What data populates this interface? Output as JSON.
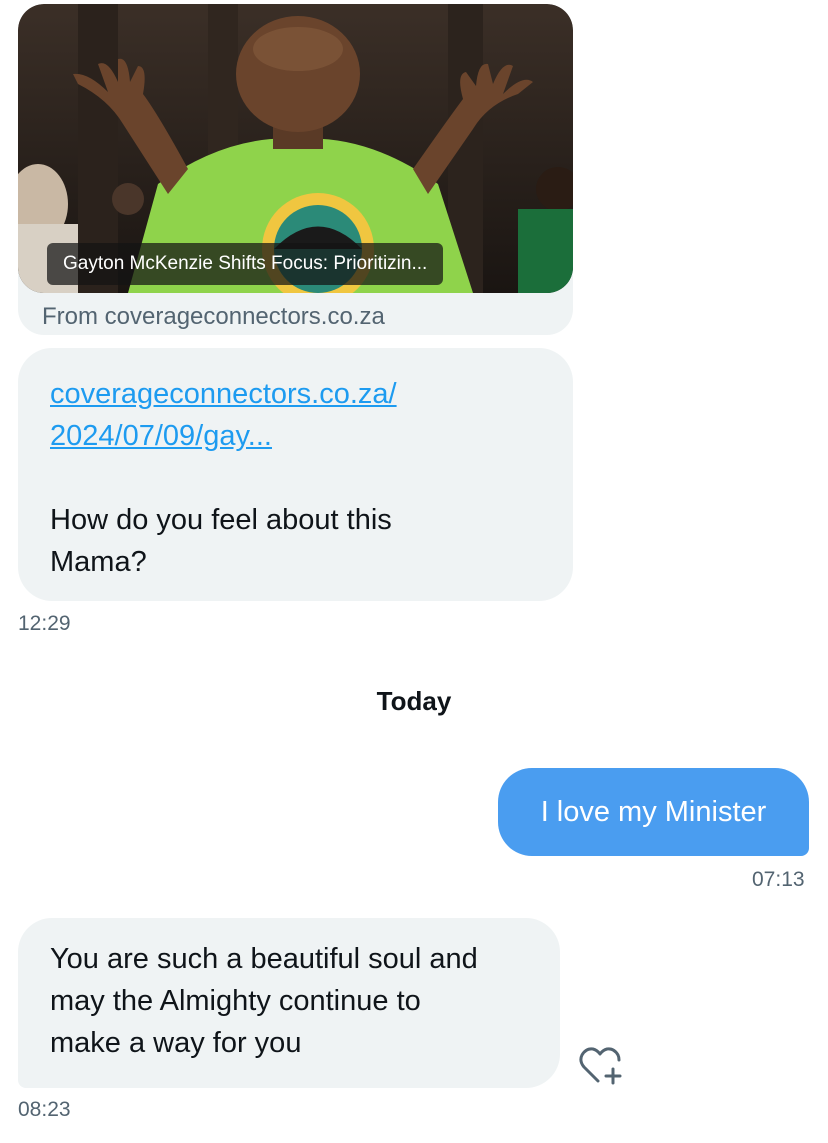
{
  "link_card": {
    "caption": "Gayton McKenzie Shifts Focus: Prioritizin...",
    "source": "From coverageconnectors.co.za",
    "image_icon": "photo-person-shrugging"
  },
  "messages": {
    "first": {
      "link_line1": "coverageconnectors.co.za/",
      "link_line2": "2024/07/09/gay...",
      "text_line1": "How do you feel about this",
      "text_line2": "Mama?",
      "time": "12:29"
    },
    "day_separator": "Today",
    "reply": {
      "text": "I love my Minister",
      "time": "07:13"
    },
    "last": {
      "text_line1": "You are such a beautiful soul and",
      "text_line2": "may the Almighty continue to",
      "text_line3": "make a way for you",
      "time": "08:23"
    }
  },
  "icons": {
    "reaction": "heart-plus-icon"
  },
  "colors": {
    "incoming_bubble": "#eff3f4",
    "outgoing_bubble": "#4a9df0",
    "link": "#1d9bf0",
    "muted_text": "#536471"
  }
}
